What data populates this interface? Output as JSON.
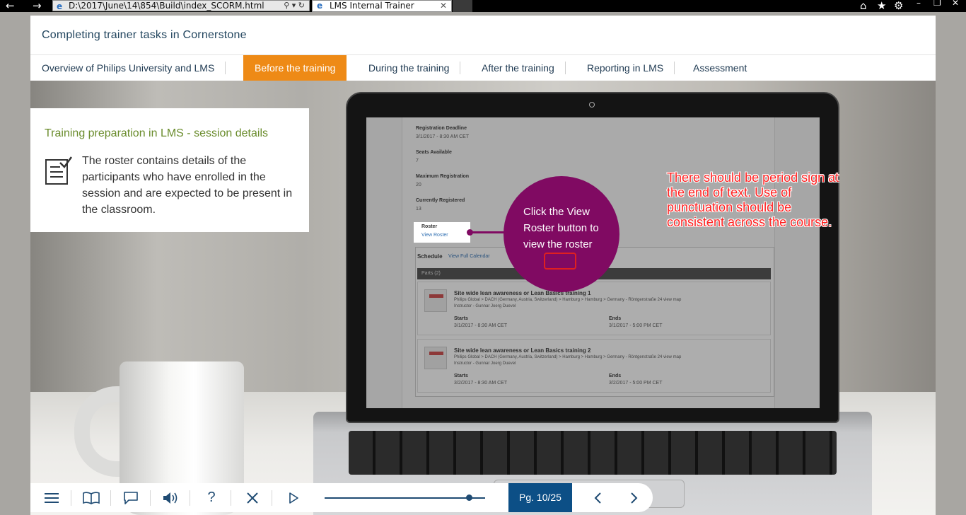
{
  "browser": {
    "address": "D:\\2017\\June\\14\\854\\Build\\index_SCORM.html",
    "tab_title": "LMS Internal Trainer"
  },
  "course": {
    "title": "Completing trainer tasks in Cornerstone"
  },
  "nav": {
    "tabs": [
      {
        "label": "Overview of Philips University and LMS"
      },
      {
        "label": "Before the training",
        "active": true
      },
      {
        "label": "During the training"
      },
      {
        "label": "After the training"
      },
      {
        "label": "Reporting in LMS"
      },
      {
        "label": "Assessment"
      }
    ]
  },
  "info": {
    "heading": "Training preparation in LMS - session details",
    "body": "The roster contains details of the participants who have enrolled in the session and are expected to be present in the classroom.",
    "icon": "checklist-icon"
  },
  "lms": {
    "reg_deadline_label": "Registration Deadline",
    "reg_deadline_value": "3/1/2017 - 8:30 AM CET",
    "seats_label": "Seats Available",
    "seats_value": "7",
    "max_reg_label": "Maximum Registration",
    "max_reg_value": "20",
    "current_reg_label": "Currently Registered",
    "current_reg_value": "13",
    "roster_label": "Roster",
    "roster_link": "View Roster",
    "schedule_label": "Schedule",
    "full_calendar_link": "View Full Calendar",
    "parts_label": "Parts (2)",
    "sessions": [
      {
        "title": "Site wide lean awareness or Lean Basics training 1",
        "location": "Philips Global > DACH (Germany, Austria, Switzerland) > Hamburg > Hamburg > Germany - Röntgenstraße 24 view map",
        "instructor": "Instructor - Gunnar Joerg Duevel",
        "starts_label": "Starts",
        "starts_value": "3/1/2017 - 8:30 AM CET",
        "ends_label": "Ends",
        "ends_value": "3/1/2017 - 5:00 PM CET"
      },
      {
        "title": "Site wide lean awareness or Lean Basics training 2",
        "location": "Philips Global > DACH (Germany, Austria, Switzerland) > Hamburg > Hamburg > Germany - Röntgenstraße 24 view map",
        "instructor": "Instructor - Gunnar Joerg Duevel",
        "starts_label": "Starts",
        "starts_value": "3/2/2017 - 8:30 AM CET",
        "ends_label": "Ends",
        "ends_value": "3/2/2017 - 5:00 PM CET"
      }
    ]
  },
  "callout": {
    "text": "Click the View Roster button to view the roster"
  },
  "review_note": "There should be period sign at the end of text. Use of punctuation should be consistent across the course.",
  "toolbar": {
    "page_indicator": "Pg. 10/25",
    "progress_fraction": 0.4,
    "icons": [
      "menu-icon",
      "glossary-book-icon",
      "comment-icon",
      "audio-icon",
      "help-icon",
      "close-icon",
      "play-icon",
      "previous-icon",
      "next-icon"
    ]
  },
  "colors": {
    "active_tab": "#ee8a16",
    "callout": "#800a62",
    "heading_green": "#6a8c2c",
    "page_indicator_bg": "#0c4f86",
    "review_red": "#ff2222"
  }
}
